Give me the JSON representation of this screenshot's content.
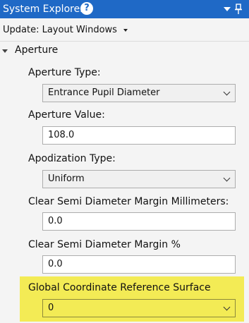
{
  "window": {
    "title": "System Explorer",
    "help_icon": "help-icon",
    "help_glyph": "?",
    "dropdown_icon": "dropdown-arrow-icon",
    "pin_icon": "pin-icon"
  },
  "update": {
    "label": "Update: Layout Windows"
  },
  "section": {
    "title": "Aperture",
    "expanded": true
  },
  "fields": {
    "aperture_type": {
      "label": "Aperture Type:",
      "value": "Entrance Pupil Diameter"
    },
    "aperture_value": {
      "label": "Aperture Value:",
      "value": "108.0"
    },
    "apodization_type": {
      "label": "Apodization Type:",
      "value": "Uniform"
    },
    "clear_semi_mm": {
      "label": "Clear Semi Diameter Margin Millimeters:",
      "value": "0.0"
    },
    "clear_semi_pct": {
      "label": "Clear Semi Diameter Margin %",
      "value": "0.0"
    },
    "global_ref_surface": {
      "label": "Global Coordinate Reference Surface",
      "value": "0"
    }
  },
  "colors": {
    "titlebar": "#1f69c6",
    "highlight": "#f3eb55",
    "panel": "#f4f4f4"
  }
}
